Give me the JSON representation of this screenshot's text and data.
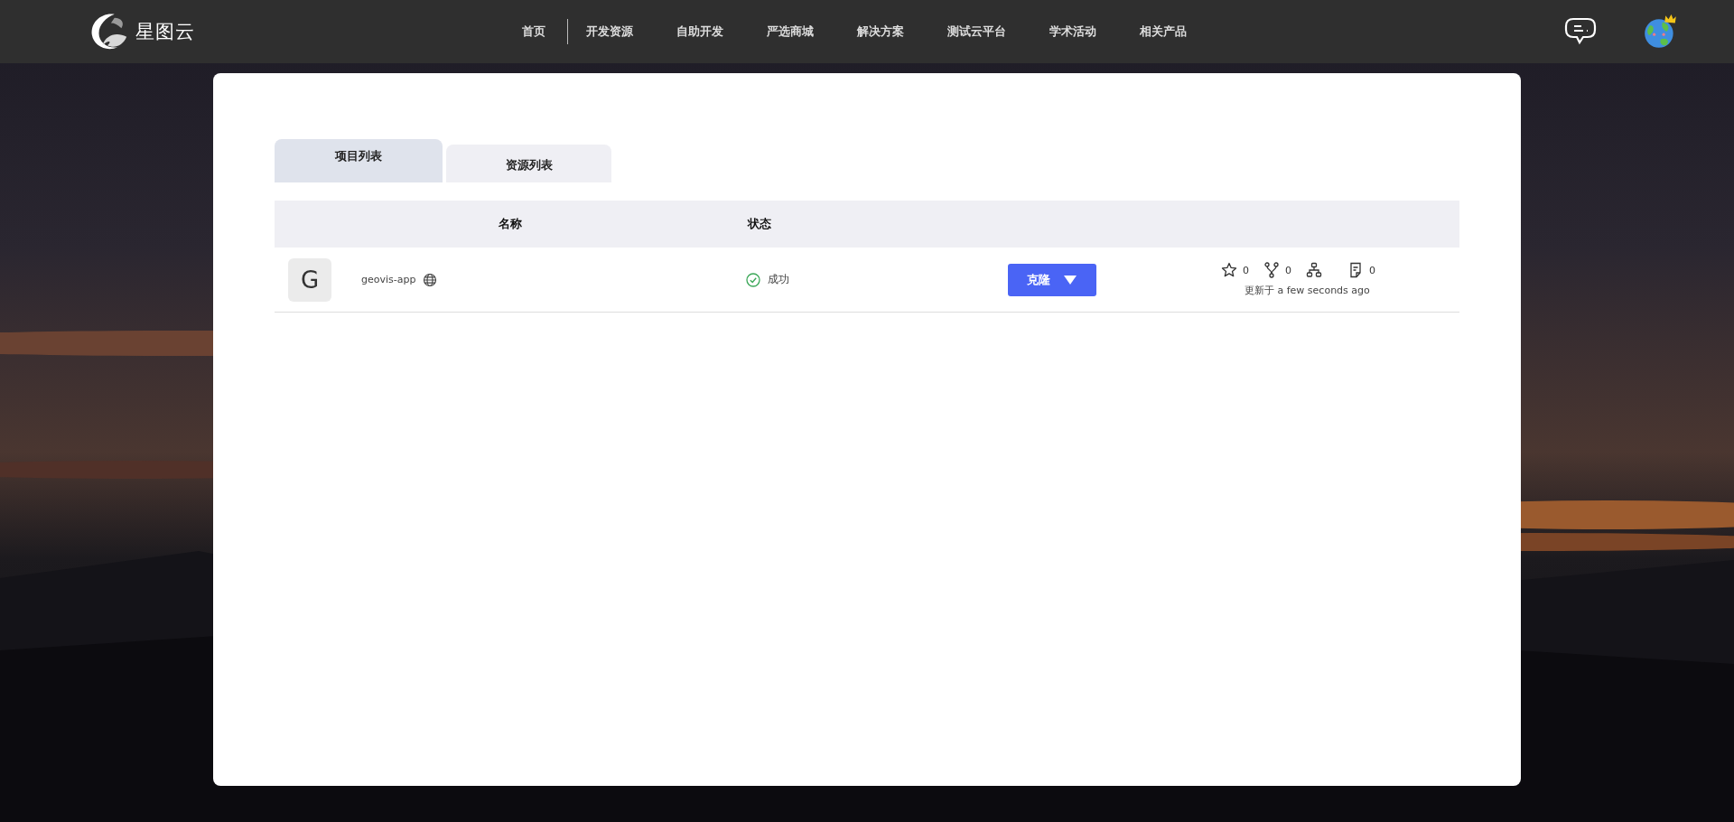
{
  "header": {
    "logo_text": "星图云",
    "nav": [
      {
        "label": "首页"
      },
      {
        "label": "开发资源"
      },
      {
        "label": "自助开发"
      },
      {
        "label": "严选商城"
      },
      {
        "label": "解决方案"
      },
      {
        "label": "测试云平台"
      },
      {
        "label": "学术活动"
      },
      {
        "label": "相关产品"
      }
    ]
  },
  "tabs": [
    {
      "label": "项目列表",
      "selected": true
    },
    {
      "label": "资源列表",
      "selected": false
    }
  ],
  "table": {
    "columns": [
      "名称",
      "状态"
    ],
    "rows": [
      {
        "avatar": "G",
        "name": "geovis-app",
        "status": "成功",
        "clone_button": "克隆",
        "star_count": "0",
        "fork_count": "0",
        "issue_count": "0",
        "updated": "更新于 a few seconds ago"
      }
    ]
  }
}
